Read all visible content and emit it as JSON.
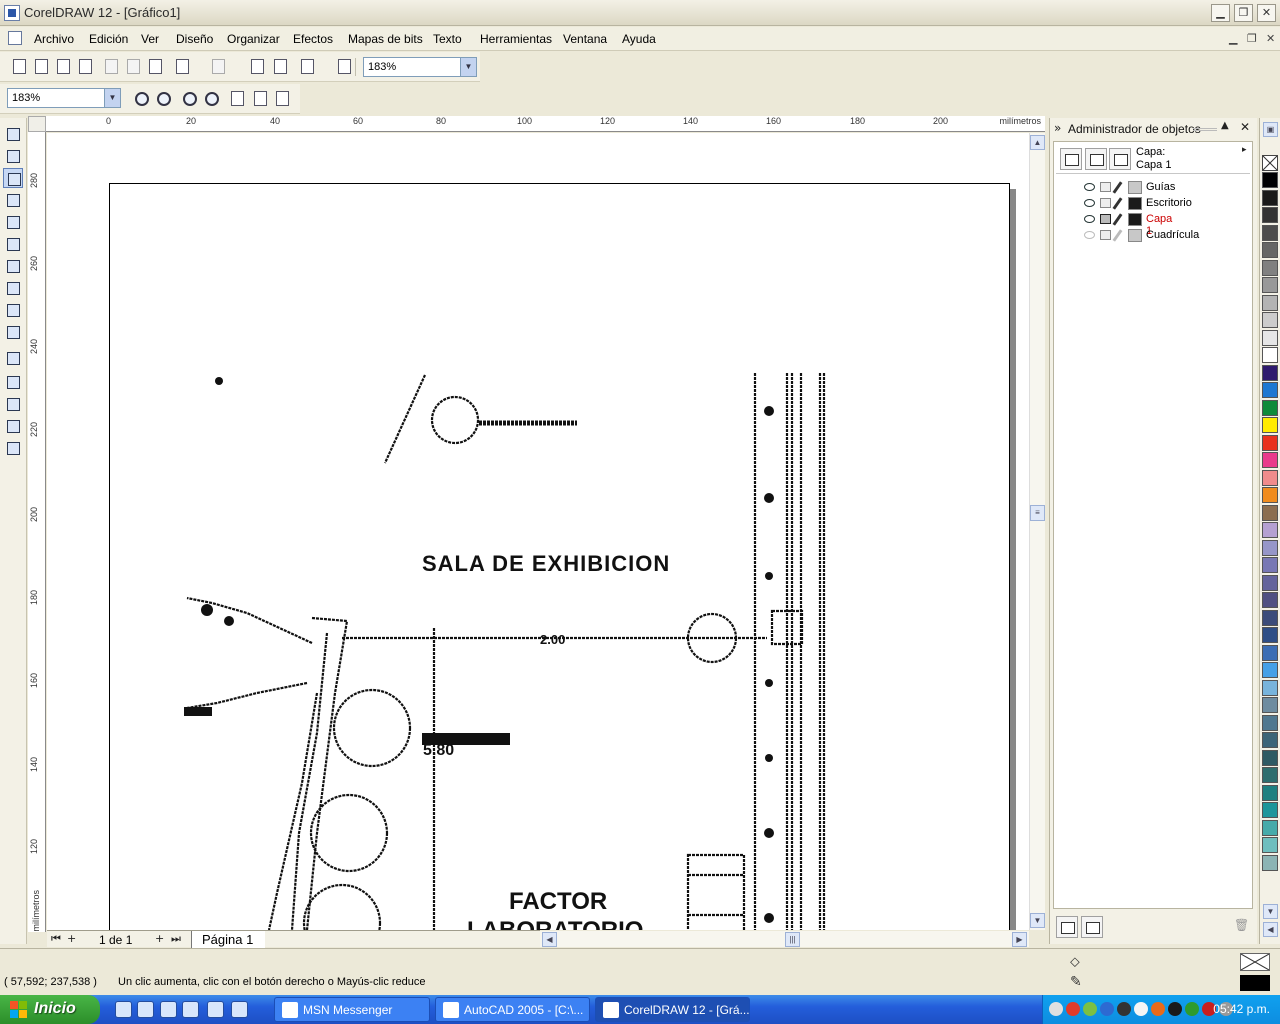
{
  "window": {
    "title": "CorelDRAW 12 - [Gráfico1]"
  },
  "menu": {
    "items": [
      {
        "label": "Archivo"
      },
      {
        "label": "Edición"
      },
      {
        "label": "Ver"
      },
      {
        "label": "Diseño"
      },
      {
        "label": "Organizar"
      },
      {
        "label": "Efectos"
      },
      {
        "label": "Mapas de bits"
      },
      {
        "label": "Texto"
      },
      {
        "label": "Herramientas"
      },
      {
        "label": "Ventana"
      },
      {
        "label": "Ayuda"
      }
    ]
  },
  "toolbar": {
    "zoom_value": "183%"
  },
  "zoom_toolbar": {
    "zoom_value": "183%"
  },
  "ruler": {
    "unit": "milímetros",
    "h_ticks": [
      "0",
      "20",
      "40",
      "60",
      "80",
      "100",
      "120",
      "140",
      "160",
      "180",
      "200"
    ],
    "v_ticks": [
      "280",
      "260",
      "240",
      "220",
      "200",
      "180",
      "160",
      "140",
      "120"
    ]
  },
  "drawing": {
    "text1": "SALA DE EXHIBICION",
    "text2": "2.00",
    "text3": "5.80",
    "text4": "FACTOR",
    "text5": "LABORATORIO"
  },
  "pages": {
    "count_label": "1 de 1",
    "tab_label": "Página 1"
  },
  "docker": {
    "title": "Administrador de objetos",
    "layer_caption_line1": "Capa:",
    "layer_caption_line2": "Capa 1",
    "layers": [
      {
        "name": "Guías",
        "color": "#c8c8c8",
        "name_color": "#000000"
      },
      {
        "name": "Escritorio",
        "color": "#1a1a1a",
        "name_color": "#000000"
      },
      {
        "name": "Capa 1",
        "color": "#1a1a1a",
        "name_color": "#cc0000"
      },
      {
        "name": "Cuadrícula",
        "color": "#c8c8c8",
        "name_color": "#000000"
      }
    ]
  },
  "palette": {
    "colors": [
      "#000000",
      "#1a1a1a",
      "#333333",
      "#4d4d4d",
      "#666666",
      "#808080",
      "#999999",
      "#b3b3b3",
      "#cccccc",
      "#e6e6e6",
      "#ffffff",
      "#2e1a6e",
      "#1e78d2",
      "#0f8a3a",
      "#ffec00",
      "#e8321e",
      "#e83a8c",
      "#f08c8c",
      "#f08c1e",
      "#8c6e50",
      "#b4a0d2",
      "#9696c8",
      "#7878b4",
      "#64649c",
      "#505082",
      "#3c4c7a",
      "#2e4e86",
      "#3c6eb4",
      "#46a0e6",
      "#78b4dc",
      "#6e8ca0",
      "#507890",
      "#3c6478",
      "#2e5a64",
      "#2e6e6e",
      "#1e8080",
      "#1e969b",
      "#46aaaa",
      "#6ebebe",
      "#8cb4b4"
    ]
  },
  "status": {
    "coords": "( 57,592; 237,538 )",
    "hint": "Un clic aumenta, clic con el botón derecho o Mayús-clic reduce"
  },
  "taskbar": {
    "start_label": "Inicio",
    "tasks": [
      {
        "label": "MSN Messenger"
      },
      {
        "label": "AutoCAD 2005 - [C:\\..."
      },
      {
        "label": "CorelDRAW 12 - [Grá..."
      }
    ],
    "clock": "05:42 p.m."
  }
}
